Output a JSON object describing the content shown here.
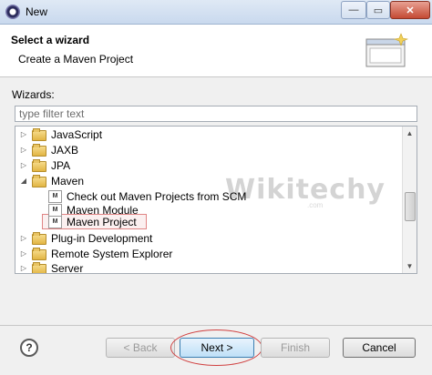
{
  "window": {
    "title": "New",
    "close_glyph": "✕",
    "minimize_glyph": "—",
    "maximize_glyph": "▭"
  },
  "header": {
    "title": "Select a wizard",
    "description": "Create a Maven Project",
    "banner_icon": "wizard-banner-icon"
  },
  "wizards": {
    "label": "Wizards:",
    "filter_placeholder": "type filter text"
  },
  "tree": {
    "items": [
      {
        "label": "JavaScript",
        "level": 0,
        "expanded": false,
        "icon": "folder-icon"
      },
      {
        "label": "JAXB",
        "level": 0,
        "expanded": false,
        "icon": "folder-icon"
      },
      {
        "label": "JPA",
        "level": 0,
        "expanded": false,
        "icon": "folder-icon"
      },
      {
        "label": "Maven",
        "level": 0,
        "expanded": true,
        "icon": "folder-icon"
      },
      {
        "label": "Check out Maven Projects from SCM",
        "level": 1,
        "icon": "maven-icon"
      },
      {
        "label": "Maven Module",
        "level": 1,
        "icon": "maven-icon"
      },
      {
        "label": "Maven Project",
        "level": 1,
        "icon": "maven-icon",
        "selected": true
      },
      {
        "label": "Plug-in Development",
        "level": 0,
        "expanded": false,
        "icon": "folder-icon"
      },
      {
        "label": "Remote System Explorer",
        "level": 0,
        "expanded": false,
        "icon": "folder-icon"
      },
      {
        "label": "Server",
        "level": 0,
        "expanded": false,
        "icon": "folder-icon"
      }
    ],
    "watermark": "Wikitechy",
    "watermark_sub": ".com"
  },
  "buttons": {
    "help": "?",
    "back": "< Back",
    "next": "Next >",
    "finish": "Finish",
    "cancel": "Cancel"
  },
  "colors": {
    "highlight_border": "#d04040",
    "next_border": "#3c7fb1"
  }
}
